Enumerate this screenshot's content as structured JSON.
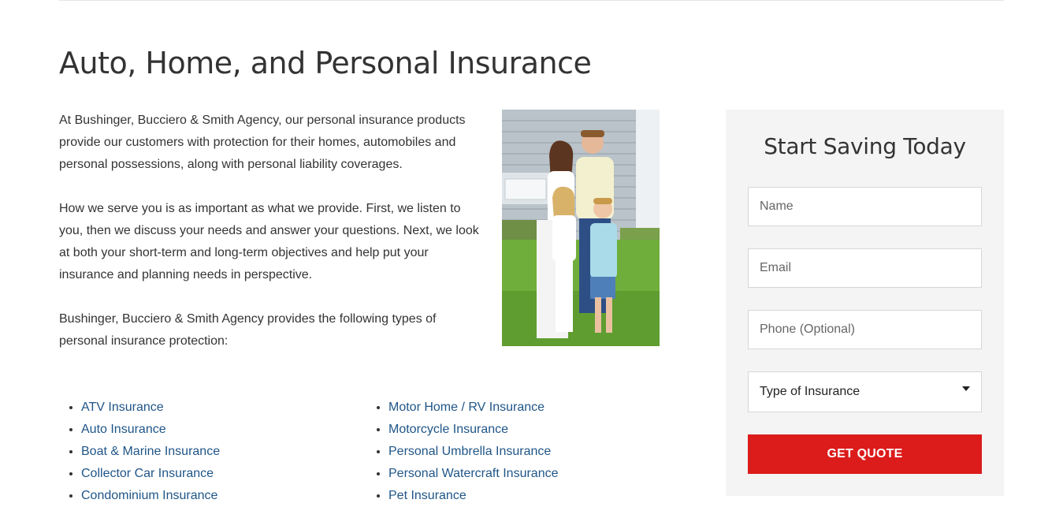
{
  "page": {
    "title": "Auto, Home, and Personal Insurance"
  },
  "intro": {
    "paragraphs": [
      "At Bushinger, Bucciero & Smith Agency, our personal insurance products provide our customers with protection for their homes, automobiles and personal possessions, along with personal liability coverages.",
      "How we serve you is as important as what we provide. First, we listen to you, then we discuss your needs and answer your questions. Next, we look at both your short-term and long-term objectives and help put your insurance and planning needs in perspective.",
      "Bushinger, Bucciero & Smith Agency provides the following types of personal insurance protection:"
    ]
  },
  "insurance_types": {
    "column1": [
      "ATV Insurance",
      "Auto Insurance",
      "Boat & Marine Insurance",
      "Collector Car Insurance",
      "Condominium Insurance"
    ],
    "column2": [
      "Motor Home / RV Insurance",
      "Motorcycle Insurance",
      "Personal Umbrella Insurance",
      "Personal Watercraft Insurance",
      "Pet Insurance"
    ]
  },
  "quote_form": {
    "heading": "Start Saving Today",
    "name_placeholder": "Name",
    "email_placeholder": "Email",
    "phone_placeholder": "Phone (Optional)",
    "type_select_value": "Type of Insurance",
    "submit_label": "GET QUOTE"
  },
  "colors": {
    "link": "#1f5587",
    "button": "#dc1b1b",
    "panel_bg": "#f4f4f4"
  }
}
